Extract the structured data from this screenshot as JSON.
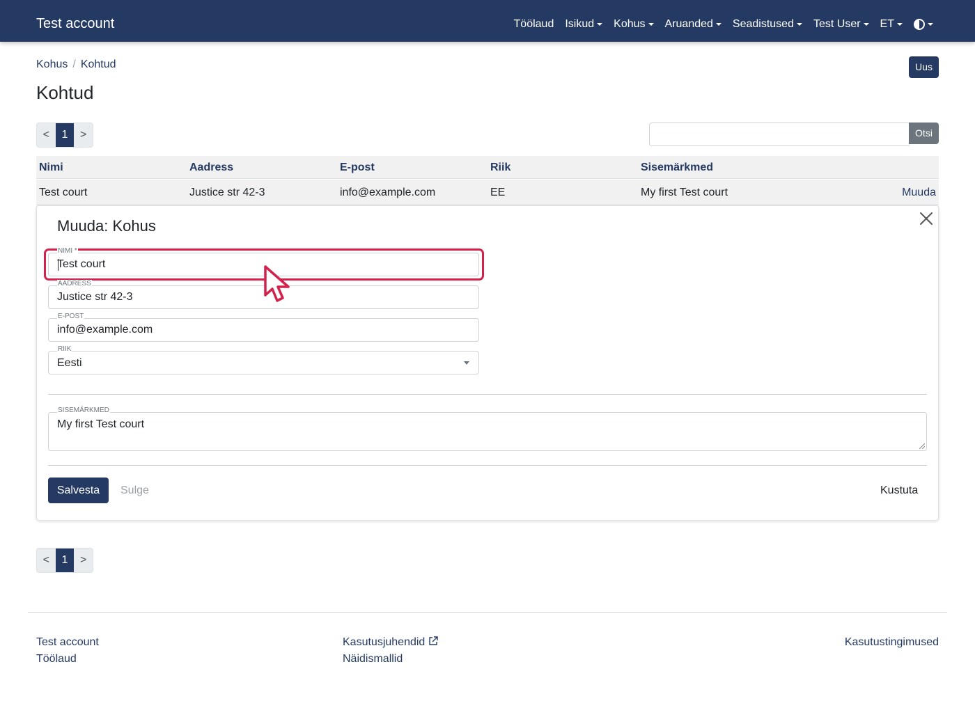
{
  "navbar": {
    "brand": "Test account",
    "items": [
      {
        "label": "Töölaud",
        "dropdown": false
      },
      {
        "label": "Isikud",
        "dropdown": true
      },
      {
        "label": "Kohus",
        "dropdown": true
      },
      {
        "label": "Aruanded",
        "dropdown": true
      },
      {
        "label": "Seadistused",
        "dropdown": true
      },
      {
        "label": "Test User",
        "dropdown": true
      },
      {
        "label": "ET",
        "dropdown": true
      }
    ],
    "theme_icon": "contrast-icon",
    "background": "#253a63"
  },
  "breadcrumb": {
    "items": [
      "Kohus",
      "Kohtud"
    ],
    "separator": "/"
  },
  "page": {
    "title": "Kohtud",
    "new_button": "Uus"
  },
  "pagination": {
    "prev": "<",
    "current": "1",
    "next": ">"
  },
  "search": {
    "value": "",
    "button": "Otsi"
  },
  "table": {
    "headers": [
      "Nimi",
      "Aadress",
      "E-post",
      "Riik",
      "Sisemärkmed"
    ],
    "rows": [
      {
        "cells": [
          "Test court",
          "Justice str 42-3",
          "info@example.com",
          "EE",
          "My first Test court"
        ],
        "action": "Muuda"
      }
    ]
  },
  "edit_form": {
    "title": "Muuda: Kohus",
    "fields": {
      "name": {
        "label": "Nimi *",
        "value": "Test court"
      },
      "address": {
        "label": "Aadress",
        "value": "Justice str 42-3"
      },
      "email": {
        "label": "E-post",
        "value": "info@example.com"
      },
      "country": {
        "label": "Riik",
        "value": "Eesti"
      },
      "notes": {
        "label": "Sisemärkmed",
        "value": "My first Test court"
      }
    },
    "buttons": {
      "save": "Salvesta",
      "close": "Sulge",
      "delete": "Kustuta"
    },
    "focus_color": "#d2224b"
  },
  "footer": {
    "left": [
      "Test account",
      "Töölaud"
    ],
    "center": [
      "Kasutusjuhendid",
      "Näidismallid"
    ],
    "right": [
      "Kasutustingimused"
    ]
  }
}
